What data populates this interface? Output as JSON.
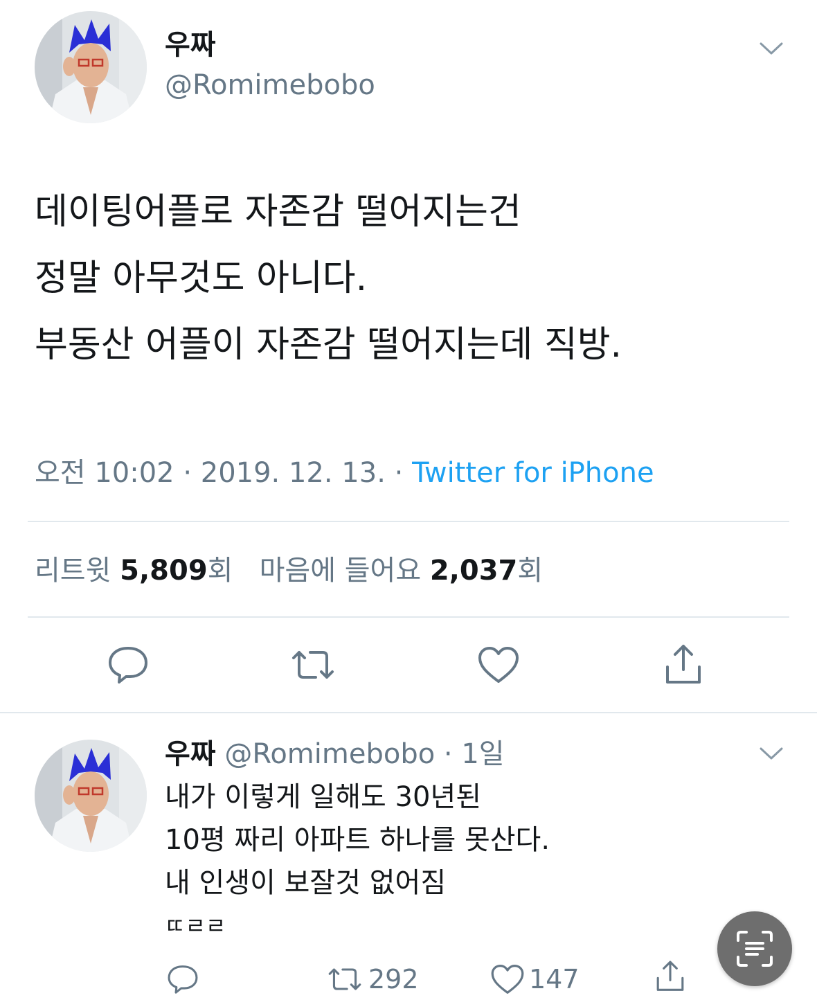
{
  "main_tweet": {
    "name": "우짜",
    "handle": "@Romimebobo",
    "text_lines": [
      "데이팅어플로 자존감 떨어지는건",
      "정말 아무것도 아니다.",
      "부동산 어플이 자존감 떨어지는데 직방."
    ],
    "time": "오전 10:02",
    "separator": "·",
    "date": "2019. 12. 13.",
    "source": "Twitter for iPhone",
    "stats": {
      "retweets_label": "리트윗",
      "retweets_count": "5,809",
      "retweets_unit": "회",
      "likes_label": "마음에 들어요",
      "likes_count": "2,037",
      "likes_unit": "회"
    },
    "actions": [
      "reply-icon",
      "retweet-icon",
      "heart-icon",
      "share-icon"
    ]
  },
  "reply_tweet": {
    "name": "우짜",
    "handle": "@Romimebobo",
    "time": "· 1일",
    "text_lines": [
      "내가 이렇게 일해도 30년된",
      "10평 짜리 아파트 하나를 못산다.",
      "내 인생이 보잘것 없어짐",
      "ㄸㄹㄹ"
    ],
    "retweet_count": "292",
    "like_count": "147"
  },
  "colors": {
    "primary_text": "#14171a",
    "secondary_text": "#657786",
    "link": "#1da1f2",
    "divider": "#e1e8ed",
    "avatar_hair": "#2a2fd6"
  },
  "floating_button": {
    "icon": "text-scan-icon"
  }
}
